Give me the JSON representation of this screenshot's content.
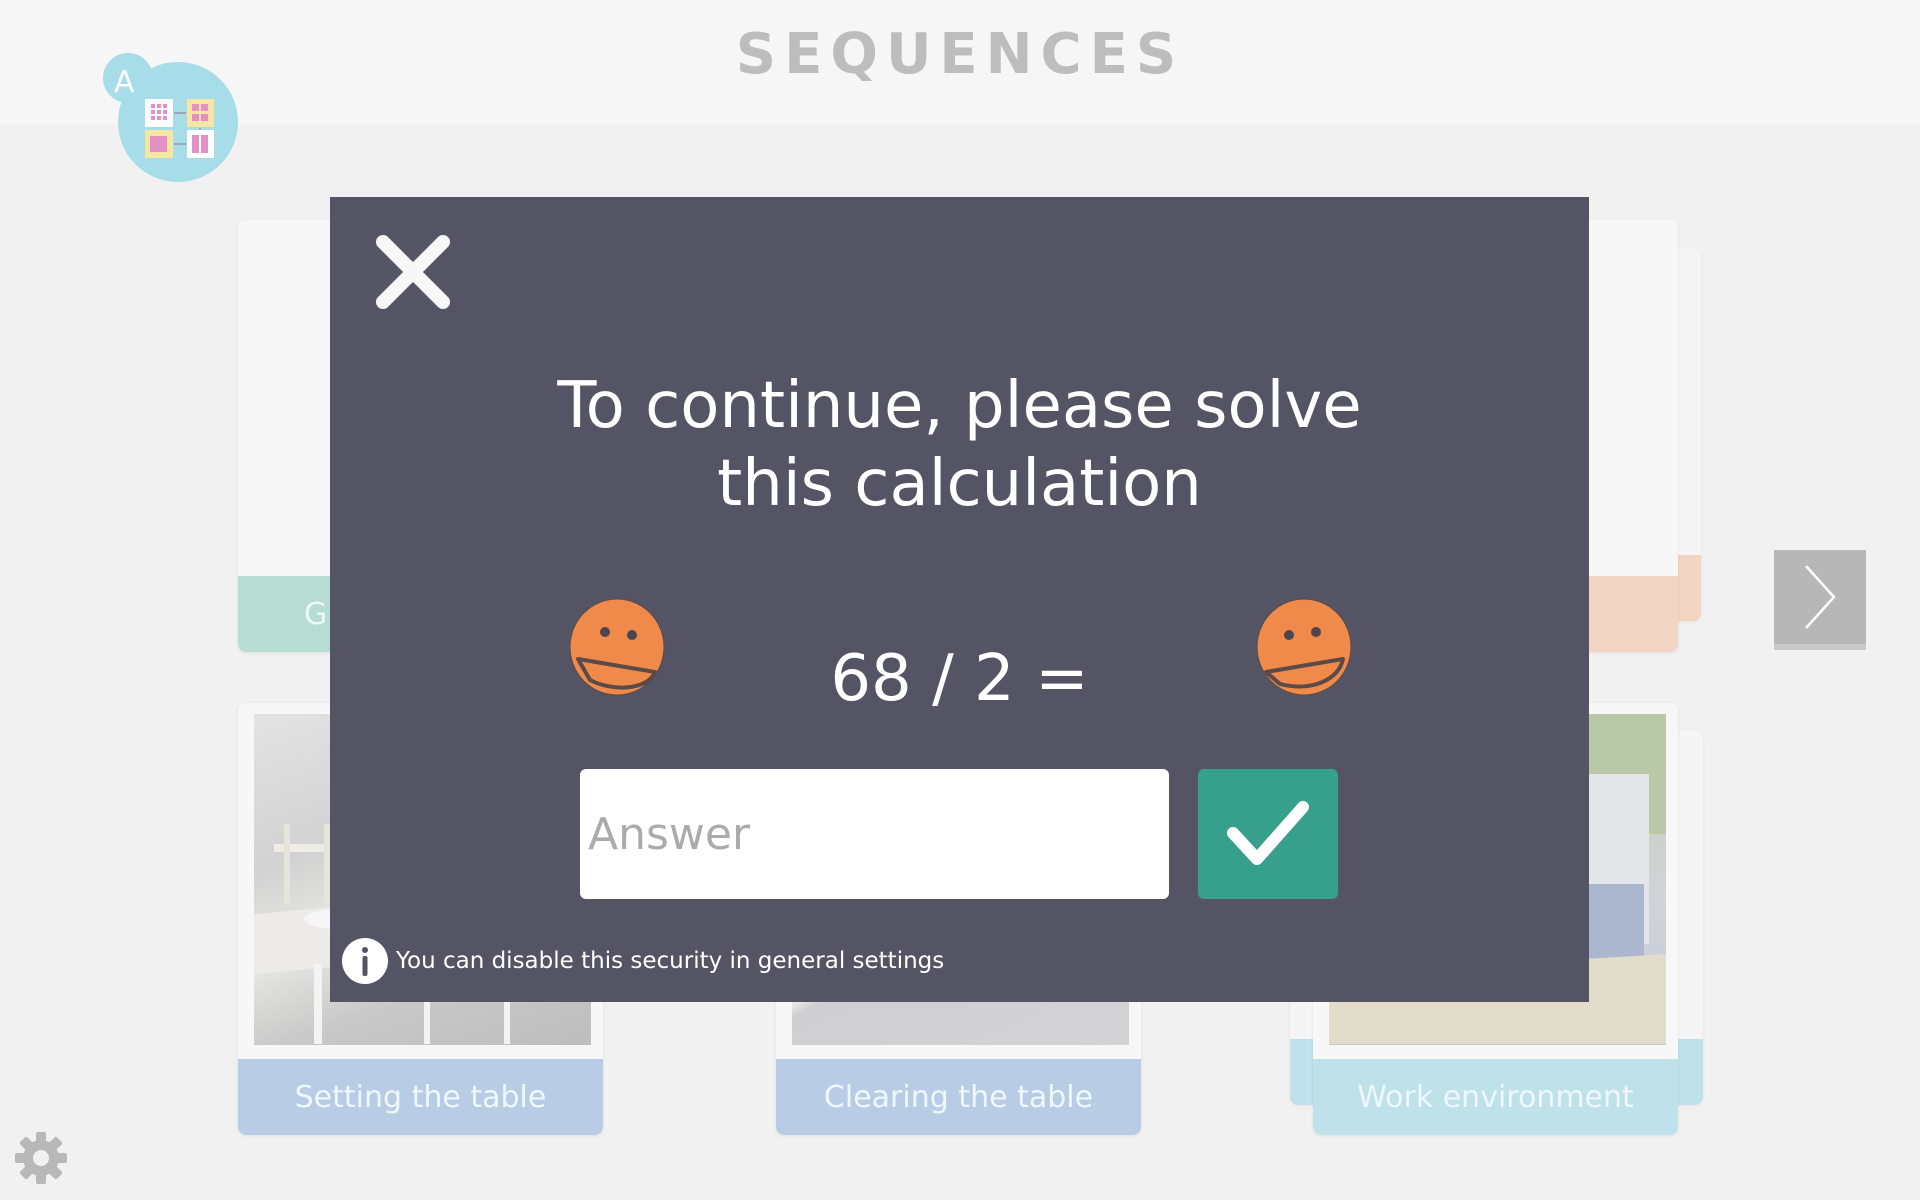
{
  "header": {
    "title": "SEQUENCES",
    "logo_icon": "sequences-app-logo-icon",
    "logo_badge_letter": "A"
  },
  "cards": [
    {
      "label": "G",
      "color": "#b6dcd3",
      "image": "blank"
    },
    {
      "label": "",
      "color": "#f2d5c2",
      "image": "blank"
    },
    {
      "label": "Setting the table",
      "color": "#b9cce6",
      "image": "dining-room-photo"
    },
    {
      "label": "Clearing the table",
      "color": "#b9cce6",
      "image": "table-surface-photo"
    },
    {
      "label": "Work environment",
      "color": "#bee1ea",
      "image": "worker-outdoors-photo"
    }
  ],
  "navigation": {
    "next_icon": "chevron-right-icon",
    "settings_icon": "gear-icon"
  },
  "modal": {
    "close_icon": "close-icon",
    "title_line1": "To continue, please solve",
    "title_line2": "this calculation",
    "equation": "68 / 2 =",
    "answer_placeholder": "Answer",
    "answer_value": "",
    "submit_icon": "checkmark-icon",
    "info_icon": "info-icon",
    "info_text": "You can disable this security in general settings",
    "colors": {
      "background": "#545464",
      "submit": "#37a08c",
      "smiley": "#f08a4b"
    }
  }
}
